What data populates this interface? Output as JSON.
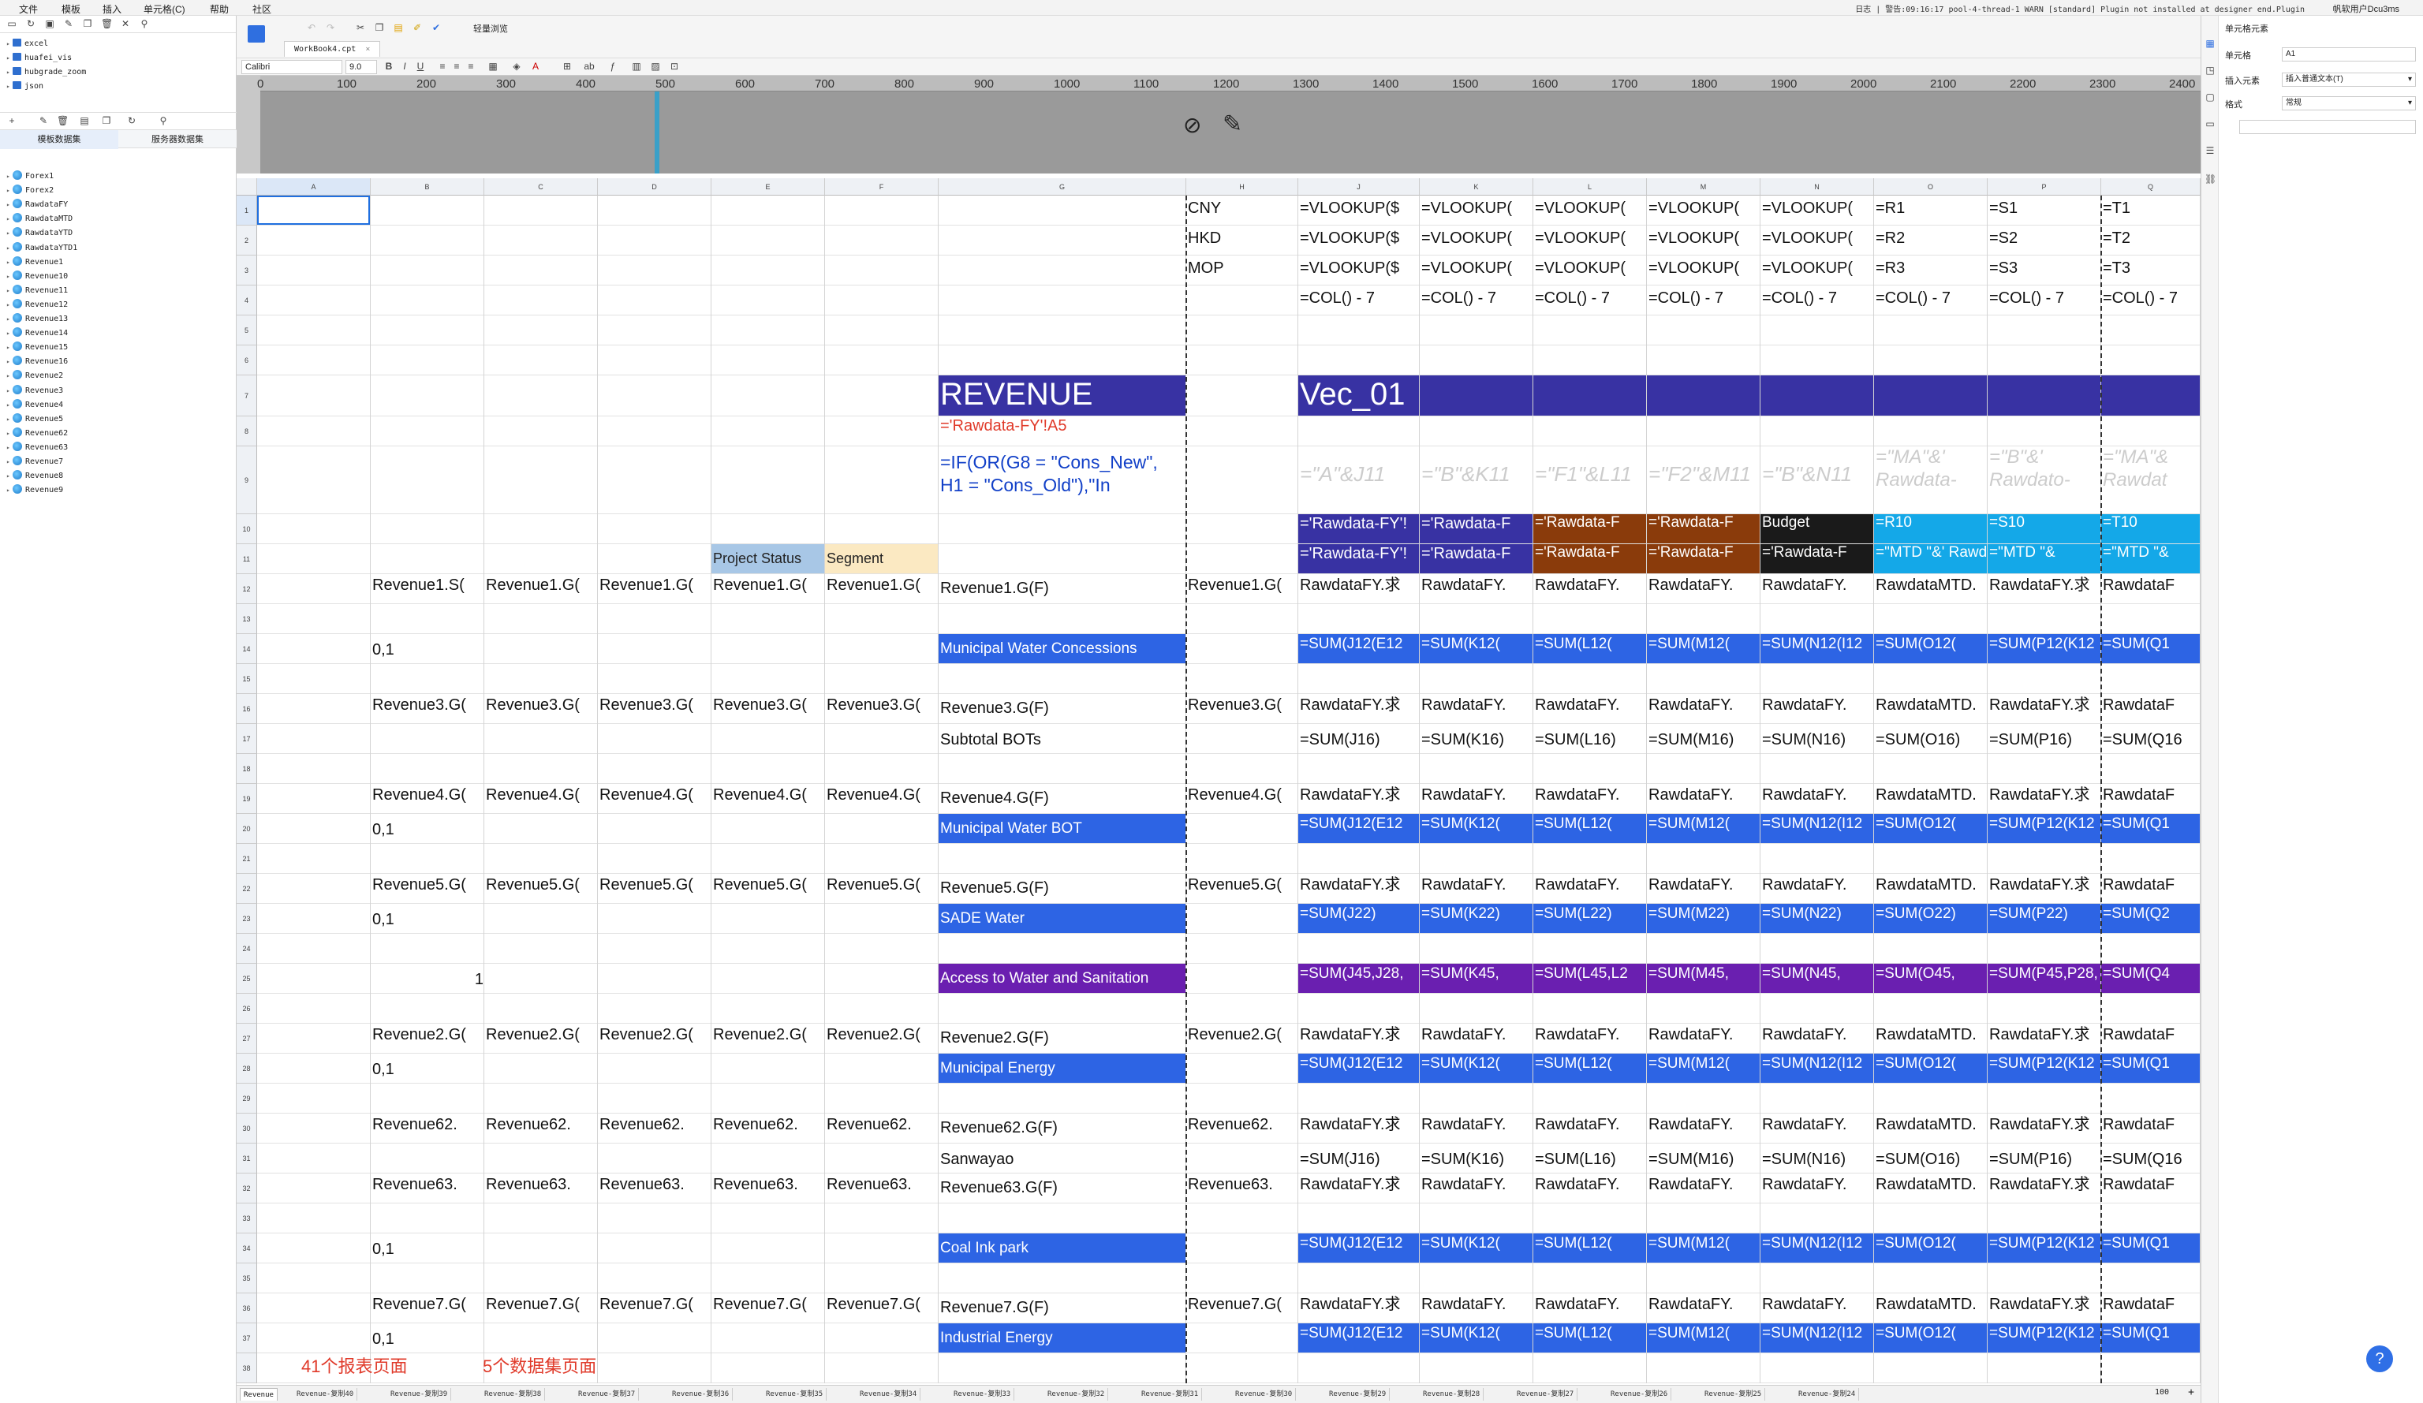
{
  "menu": {
    "items": [
      "文件",
      "模板",
      "插入",
      "单元格(C)",
      "帮助",
      "社区"
    ]
  },
  "status": {
    "message": "日志 | 警告:09:16:17 pool-4-thread-1 WARN [standard] Plugin not installed at designer end.Plugin",
    "user": "帆软用户Dcu3ms"
  },
  "left_panel": {
    "tree_top": [
      "excel",
      "huafei_vis",
      "hubgrade_zoom",
      "json"
    ],
    "tabs": [
      "模板数据集",
      "服务器数据集"
    ],
    "datasets": [
      "Forex1",
      "Forex2",
      "RawdataFY",
      "RawdataMTD",
      "RawdataYTD",
      "RawdataYTD1",
      "Revenue1",
      "Revenue10",
      "Revenue11",
      "Revenue12",
      "Revenue13",
      "Revenue14",
      "Revenue15",
      "Revenue16",
      "Revenue2",
      "Revenue3",
      "Revenue4",
      "Revenue5",
      "Revenue62",
      "Revenue63",
      "Revenue7",
      "Revenue8",
      "Revenue9"
    ]
  },
  "doc": {
    "filename": "WorkBook4.cpt",
    "toolbar_label": "轻量浏览",
    "font": "Calibri",
    "font_size": "9.0"
  },
  "ruler": {
    "labels": [
      "0",
      "100",
      "200",
      "300",
      "400",
      "500",
      "600",
      "700",
      "800",
      "900",
      "1000",
      "1100",
      "1200",
      "1300",
      "1400",
      "1500",
      "1600",
      "1700",
      "1800",
      "1900",
      "2000",
      "2100",
      "2200",
      "2300",
      "2400"
    ]
  },
  "grid": {
    "columns": [
      "A",
      "B",
      "C",
      "D",
      "E",
      "F",
      "G",
      "H",
      "J",
      "K",
      "L",
      "M",
      "N",
      "O",
      "P",
      "Q"
    ],
    "rows": [
      "1",
      "2",
      "3",
      "4",
      "5",
      "6",
      "7",
      "8",
      "9",
      "10",
      "11",
      "12",
      "13",
      "14",
      "15",
      "16",
      "17",
      "18",
      "19",
      "20",
      "21",
      "22",
      "23",
      "24",
      "25",
      "26",
      "27",
      "28",
      "29",
      "30",
      "31",
      "32",
      "33",
      "34",
      "35",
      "36",
      "37",
      "38"
    ],
    "cells": {
      "h1": "CNY",
      "h2": "HKD",
      "h3": "MOP",
      "vlookup": "=VLOOKUP($",
      "vlookup2": "=VLOOKUP(",
      "r1": "=R1",
      "s1": "=S1",
      "t1": "=T1",
      "r2": "=R2",
      "s2": "=S2",
      "t2": "=T2",
      "r3": "=R3",
      "s3": "=S3",
      "t3": "=T3",
      "col7": "=COL() - 7",
      "revenue": "REVENUE",
      "vec": "Vec_01",
      "rawdata_a5": "='Rawdata-FY'!A5",
      "if_formula": "=IF(OR(G8 = \"Cons_New\", H1 = \"Cons_Old\"),\"In",
      "ghost_j": "=\"A\"&J11",
      "ghost_k": "=\"B\"&K11",
      "ghost_l": "=\"F1\"&L11",
      "ghost_m": "=\"F2\"&M11",
      "ghost_n": "=\"B\"&N11",
      "ghost_o": "=\"MA\"&' Rawdata-",
      "ghost_p": "=\"B\"&' Rawdato-",
      "ghost_q": "=\"MA\"& Rawdat",
      "rawfy": "='Rawdata-FY'!",
      "rawf": "='Rawdata-F",
      "budget": "Budget",
      "r10": "=R10",
      "s10": "=S10",
      "t10": "=T10",
      "mtd": "=\"MTD \"&' Rawdata-YTD'!",
      "mtd2": "=\"MTD \"&",
      "project_status": "Project Status",
      "segment": "Segment",
      "rev1_s": "Revenue1.S(",
      "rev1_g": "Revenue1.G(",
      "rev1_gf": "Revenue1.G(F)",
      "rawfy_q": "RawdataFY.求",
      "rawfy_d": "RawdataFY.",
      "rawmtd": "RawdataMTD.",
      "rawf_short": "RawdataF",
      "zero_one": "0,1",
      "one": "1",
      "municipal_water_conc": "Municipal Water Concessions",
      "sum_j12": "=SUM(J12(E12",
      "sum_k12": "=SUM(K12(",
      "sum_l12": "=SUM(L12(",
      "sum_m12": "=SUM(M12(",
      "sum_n12": "=SUM(N12(I12",
      "sum_o12": "=SUM(O12(",
      "sum_p12": "=SUM(P12(K12",
      "sum_q1": "=SUM(Q1",
      "rev3_g": "Revenue3.G(",
      "rev3_gf": "Revenue3.G(F)",
      "subtotal_bots": "Subtotal BOTs",
      "sum_j16": "=SUM(J16)",
      "sum_k16": "=SUM(K16)",
      "sum_l16": "=SUM(L16)",
      "sum_m16": "=SUM(M16)",
      "sum_n16": "=SUM(N16)",
      "sum_o16": "=SUM(O16)",
      "sum_p16": "=SUM(P16)",
      "sum_q16": "=SUM(Q16",
      "rev4_g": "Revenue4.G(",
      "rev4_gf": "Revenue4.G(F)",
      "municipal_water_bot": "Municipal Water BOT",
      "rev5_g": "Revenue5.G(",
      "rev5_gf": "Revenue5.G(F)",
      "sade_water": "SADE Water",
      "sum_j22": "=SUM(J22)",
      "sum_k22": "=SUM(K22)",
      "sum_l22": "=SUM(L22)",
      "sum_m22": "=SUM(M22)",
      "sum_n22": "=SUM(N22)",
      "sum_o22": "=SUM(O22)",
      "sum_p22": "=SUM(P22)",
      "sum_q2": "=SUM(Q2",
      "access_water": "Access to Water and Sanitation",
      "sum_j45": "=SUM(J45,J28,",
      "sum_k45": "=SUM(K45,",
      "sum_l45": "=SUM(L45,L2",
      "sum_m45": "=SUM(M45,",
      "sum_n45": "=SUM(N45,",
      "sum_o45": "=SUM(O45,",
      "sum_p45": "=SUM(P45,P28,",
      "sum_q4": "=SUM(Q4",
      "rev2_g": "Revenue2.G(",
      "rev2_gf": "Revenue2.G(F)",
      "municipal_energy": "Municipal Energy",
      "rev62": "Revenue62.",
      "rev62_gf": "Revenue62.G(F)",
      "sanwayao": "Sanwayao",
      "rev63": "Revenue63.",
      "rev63_gf": "Revenue63.G(F)",
      "coal_ink_park": "Coal Ink park",
      "rev7_g": "Revenue7.G(",
      "rev7_gf": "Revenue7.G(F)",
      "industrial_energy": "Industrial Energy",
      "note_41": "41个报表页面",
      "note_5": "5个数据集页面"
    }
  },
  "sheet_tabs": [
    "Revenue",
    "Revenue-复制40",
    "Revenue-复制39",
    "Revenue-复制38",
    "Revenue-复制37",
    "Revenue-复制36",
    "Revenue-复制35",
    "Revenue-复制34",
    "Revenue-复制33",
    "Revenue-复制32",
    "Revenue-复制31",
    "Revenue-复制30",
    "Revenue-复制29",
    "Revenue-复制28",
    "Revenue-复制27",
    "Revenue-复制26",
    "Revenue-复制25",
    "Revenue-复制24"
  ],
  "zoom": "100",
  "right_panel": {
    "title": "单元格元素",
    "cell_label": "单元格",
    "cell_value": "A1",
    "insert_label": "插入元素",
    "insert_value": "插入普通文本(T)",
    "format_label": "格式",
    "format_value": "常规"
  },
  "colors": {
    "blue": "#2d64e4",
    "navy": "#3832a3",
    "purple": "#6a1fb0",
    "brown": "#8a3b0b",
    "cyan": "#14a8e8"
  }
}
